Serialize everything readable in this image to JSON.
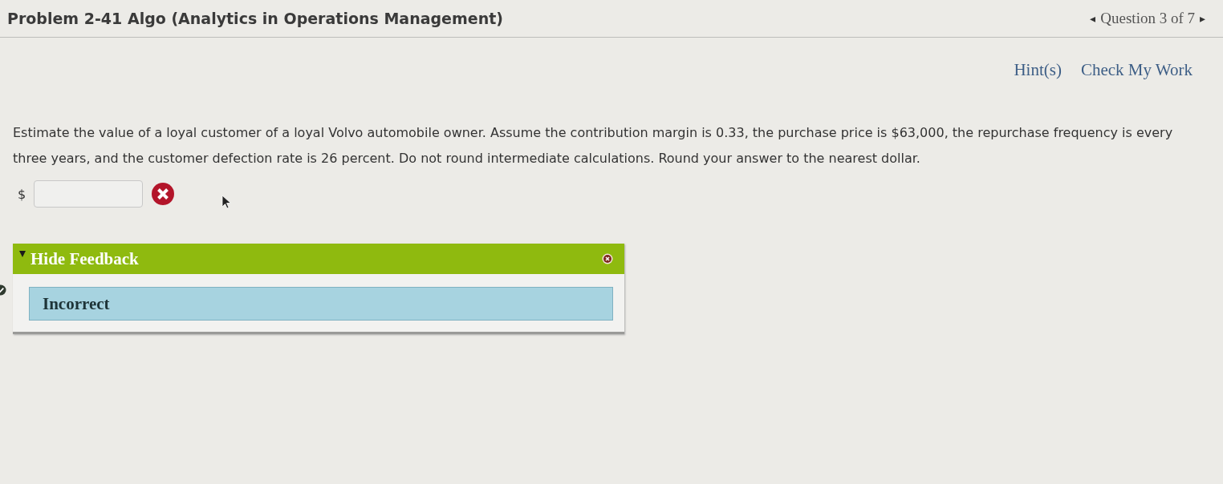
{
  "header": {
    "title": "Problem 2-41 Algo (Analytics in Operations Management)",
    "prev": "◂",
    "position": "Question 3 of 7",
    "next": "▸"
  },
  "links": [
    "Hint(s)",
    "Check My Work"
  ],
  "question": "Estimate the value of a loyal customer of a loyal Volvo automobile owner. Assume the contribution margin is 0.33, the purchase price is $63,000, the repurchase frequency is every three years, and the customer defection rate is 26 percent. Do not round intermediate calculations. Round your answer to the nearest dollar.",
  "answer": {
    "currency": "$",
    "correct": false
  },
  "sidebar": {
    "checked": true
  },
  "feedback": {
    "expanded": true,
    "toggle": "Hide Feedback",
    "message": "Incorrect"
  }
}
